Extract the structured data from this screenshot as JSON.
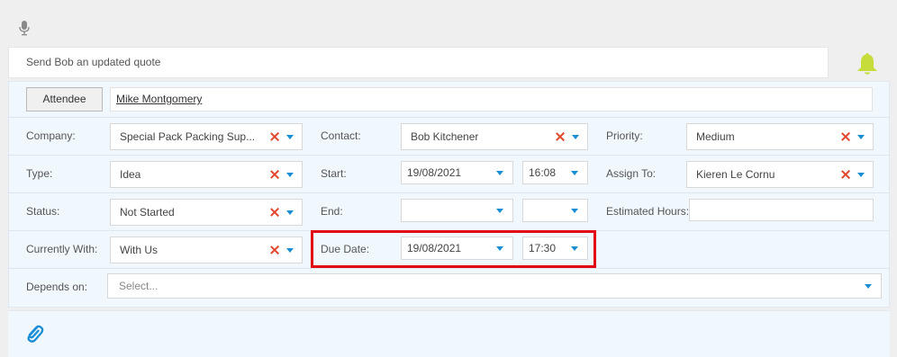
{
  "subject": "Send Bob an updated quote",
  "attendee": {
    "button_label": "Attendee",
    "name": "Mike Montgomery"
  },
  "fields": {
    "company": {
      "label": "Company:",
      "value": "Special Pack Packing Sup..."
    },
    "contact": {
      "label": "Contact:",
      "value": "Bob Kitchener"
    },
    "priority": {
      "label": "Priority:",
      "value": "Medium"
    },
    "type": {
      "label": "Type:",
      "value": "Idea"
    },
    "start": {
      "label": "Start:",
      "date": "19/08/2021",
      "time": "16:08"
    },
    "assign_to": {
      "label": "Assign To:",
      "value": "Kieren Le Cornu"
    },
    "status": {
      "label": "Status:",
      "value": "Not Started"
    },
    "end": {
      "label": "End:",
      "date": "",
      "time": ""
    },
    "estimated_hours": {
      "label": "Estimated Hours:",
      "value": ""
    },
    "currently_with": {
      "label": "Currently With:",
      "value": "With Us"
    },
    "due_date": {
      "label": "Due Date:",
      "date": "19/08/2021",
      "time": "17:30"
    },
    "depends_on": {
      "label": "Depends on:",
      "placeholder": "Select..."
    }
  },
  "icons": {
    "microphone": "microphone-icon",
    "bell": "bell-icon",
    "paperclip": "paperclip-icon",
    "clear": "clear-x-icon",
    "caret": "caret-down-icon"
  },
  "colors": {
    "accent_blue": "#1a8ed4",
    "clear_red": "#e2472f",
    "bell_yellow": "#c6dc3a",
    "highlight_red": "#e30613"
  }
}
